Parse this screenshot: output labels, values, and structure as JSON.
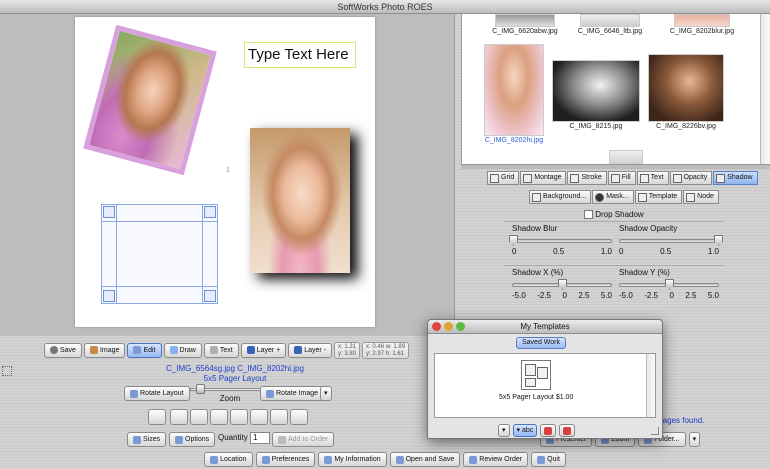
{
  "window": {
    "title": "SoftWorks Photo ROES"
  },
  "canvas": {
    "text_box": "Type Text Here",
    "page_number": "1"
  },
  "thumbnails": {
    "top_row": [
      "C_IMG_6620abw.jpg",
      "C_IMG_6646_ltb.jpg",
      "C_IMG_8202blur.jpg"
    ],
    "second_row": [
      {
        "label": "C_IMG_8202hi.jpg",
        "selected": true
      },
      {
        "label": "C_IMG_8215.jpg",
        "selected": false
      },
      {
        "label": "C_IMG_8226bv.jpg",
        "selected": false
      }
    ]
  },
  "tool_tabs": {
    "row1": [
      {
        "label": "Grid",
        "icon": "grid-icon",
        "active": false
      },
      {
        "label": "Montage",
        "icon": "montage-icon",
        "active": false
      },
      {
        "label": "Stroke",
        "icon": "stroke-icon",
        "active": false
      },
      {
        "label": "Fill",
        "icon": "fill-icon",
        "active": false
      },
      {
        "label": "Text",
        "icon": "text-icon",
        "active": false
      },
      {
        "label": "Opacity",
        "icon": "opacity-icon",
        "active": false
      },
      {
        "label": "Shadow",
        "icon": "shadow-icon",
        "active": true
      }
    ],
    "row2": [
      {
        "label": "Background...",
        "icon": "background-icon"
      },
      {
        "label": "Mask...",
        "icon": "mask-icon"
      },
      {
        "label": "Template",
        "icon": "template-icon"
      },
      {
        "label": "Node",
        "icon": "node-icon"
      }
    ]
  },
  "shadow": {
    "drop_shadow_label": "Drop Shadow",
    "drop_shadow_checked": false,
    "sliders": [
      {
        "title": "Shadow Blur",
        "ticks": [
          "0",
          "0.5",
          "1.0"
        ],
        "value": 0.0
      },
      {
        "title": "Shadow Opacity",
        "ticks": [
          "0",
          "0.5",
          "1.0"
        ],
        "value": 1.0
      },
      {
        "title": "Shadow X (%)",
        "ticks": [
          "-5.0",
          "-2.5",
          "0",
          "2.5",
          "5.0"
        ],
        "value": 0.0
      },
      {
        "title": "Shadow Y (%)",
        "ticks": [
          "-5.0",
          "-2.5",
          "0",
          "2.5",
          "5.0"
        ],
        "value": 0.0
      }
    ]
  },
  "toolbar": {
    "save": "Save",
    "image": "Image",
    "edit": "Edit",
    "draw": "Draw",
    "text": "Text",
    "layer_plus": "Layer +",
    "layer_minus": "Layer -",
    "coords1_line1": "x: 1.31",
    "coords1_line2": "y: 3.80",
    "coords2_line1": "x: 0.46 w: 1.89",
    "coords2_line2": "y: 2.97 h: 1.61"
  },
  "info": {
    "files": "C_IMG_6564sg.jpg  C_IMG_8202hi.jpg",
    "layout": "5x5 Pager Layout"
  },
  "controls": {
    "rotate_layout": "Rotate Layout",
    "zoom": "Zoom",
    "rotate_image": "Rotate Image",
    "sizes": "Sizes",
    "options": "Options",
    "quantity_label": "Quantity",
    "quantity_value": "1",
    "add_to_order": "Add to Order"
  },
  "right_actions": {
    "images_found": "mages found.",
    "presenter": "Presenter",
    "zoom": "Zoom",
    "folder": "Folder..."
  },
  "bottom_bar": [
    "Location",
    "Preferences",
    "My Information",
    "Open and Save",
    "Review Order",
    "Quit"
  ],
  "dialog": {
    "title": "My Templates",
    "tab": "Saved Work",
    "item": "5x5 Pager Layout $1.00",
    "footer_buttons": [
      "",
      "abc",
      "",
      ""
    ]
  }
}
